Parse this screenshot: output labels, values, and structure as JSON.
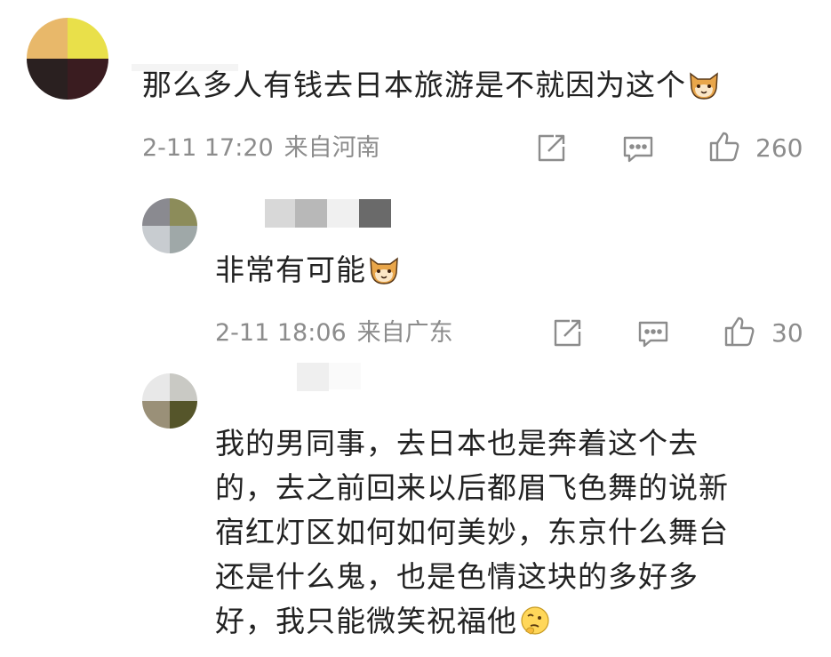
{
  "comments": [
    {
      "content": "那么多人有钱去日本旅游是不就因为这个",
      "emoji": "cat-face-emoji",
      "time": "2-11 17:20",
      "location": "来自河南",
      "likes": "260"
    },
    {
      "content": "非常有可能",
      "emoji": "cat-face-emoji",
      "time": "2-11 18:06",
      "location": "来自广东",
      "likes": "30"
    },
    {
      "lines": [
        "我的男同事，去日本也是奔着这个去",
        "的，去之前回来以后都眉飞色舞的说新",
        "宿红灯区如何如何美妙，东京什么舞台",
        "还是什么鬼，也是色情这块的多好多",
        "好，我只能微笑祝福他"
      ],
      "emoji": "thinking-face-emoji"
    }
  ],
  "colors": {
    "meta_text": "#8c8c8c",
    "content_text": "#222222"
  }
}
